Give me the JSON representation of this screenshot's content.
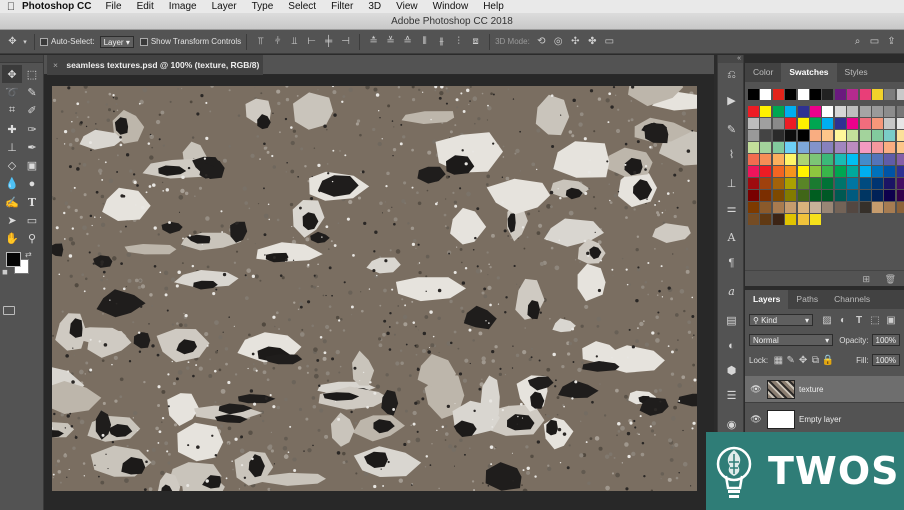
{
  "menubar": {
    "apple_icon": "apple-icon",
    "app_name": "Photoshop CC",
    "items": [
      "File",
      "Edit",
      "Image",
      "Layer",
      "Type",
      "Select",
      "Filter",
      "3D",
      "View",
      "Window",
      "Help"
    ]
  },
  "window": {
    "title": "Adobe Photoshop CC 2018"
  },
  "options": {
    "auto_select_label": "Auto-Select:",
    "auto_select_value": "Layer",
    "show_transform_label": "Show Transform Controls",
    "mode_3d_label": "3D Mode:"
  },
  "document": {
    "tab_title": "seamless textures.psd @ 100% (texture, RGB/8)",
    "close_glyph": "×"
  },
  "swatches_panel": {
    "tabs": [
      "Color",
      "Swatches",
      "Styles"
    ],
    "active_tab": "Swatches",
    "rows": [
      [
        "#000000",
        "#ffffff",
        "#e2231a",
        "#000000",
        "#ffffff",
        "#000000",
        "#222222",
        "#6a1a7e",
        "#b52a8e",
        "#e93e78",
        "#f2d22b",
        "#7d7d7d",
        "#c9c9c9"
      ],
      [
        "#ed1c24",
        "#fff200",
        "#00a651",
        "#00aeef",
        "#2e3192",
        "#ec008c",
        "#ffffff",
        "#d7d7d7",
        "#bfbfbf",
        "#a5a5a5",
        "#9a9a9a",
        "#8c8c8c",
        "#777777"
      ],
      [
        "#bdbdbd",
        "#a0a0a0",
        "#8a8a8a",
        "#ed1c24",
        "#fff200",
        "#00a651",
        "#00aeef",
        "#2e3192",
        "#ec008c",
        "#f26d7d",
        "#f7977a",
        "#c7c7c7",
        "#e6e6e6"
      ],
      [
        "#999999",
        "#444444",
        "#2b2b2b",
        "#0d0d0d",
        "#000000",
        "#f9ad81",
        "#fdc68a",
        "#fff79a",
        "#c4df9b",
        "#a3d39c",
        "#82ca9d",
        "#7accc8",
        "#fbe09a"
      ],
      [
        "#c4df9b",
        "#a3d39c",
        "#82ca9d",
        "#6dcff6",
        "#7da7d9",
        "#8393ca",
        "#8781bd",
        "#a186be",
        "#bd8cbf",
        "#f49ac1",
        "#f5989d",
        "#f9ad81",
        "#fdc68a"
      ],
      [
        "#f26c4f",
        "#f68e56",
        "#fbaf5d",
        "#fff568",
        "#acd372",
        "#7cc576",
        "#3bb878",
        "#1abbb4",
        "#00bff3",
        "#438ccb",
        "#5574b9",
        "#605ca8",
        "#855fa8"
      ],
      [
        "#ed145b",
        "#ed1c24",
        "#f26522",
        "#f7941d",
        "#fff200",
        "#8dc63f",
        "#39b54a",
        "#00a651",
        "#00a99d",
        "#00aeef",
        "#0072bc",
        "#0054a6",
        "#2e3192"
      ],
      [
        "#9e0b0f",
        "#a0410d",
        "#a36209",
        "#aba000",
        "#598527",
        "#1a7b30",
        "#007236",
        "#00746b",
        "#0076a3",
        "#004b80",
        "#003471",
        "#1b1464",
        "#440e62"
      ],
      [
        "#790000",
        "#7b2e00",
        "#7d4900",
        "#827b00",
        "#406618",
        "#005e20",
        "#005826",
        "#005952",
        "#005b7f",
        "#003663",
        "#002157",
        "#0d004c",
        "#32004b"
      ],
      [
        "#7d3a00",
        "#8b5a2b",
        "#a87b4f",
        "#c69c6d",
        "#d9b27c",
        "#c7b299",
        "#998675",
        "#736357",
        "#534741",
        "#36302a",
        "#c69c6d",
        "#a67c52",
        "#8c6239"
      ],
      [
        "#754c24",
        "#603913",
        "#3c2415",
        "#e0c300",
        "#f0c23b",
        "#f5e11a",
        "",
        "",
        "",
        "",
        "",
        "",
        ""
      ]
    ],
    "footer_icons": [
      "new-swatch-icon",
      "delete-icon"
    ]
  },
  "layers_panel": {
    "tabs": [
      "Layers",
      "Paths",
      "Channels"
    ],
    "active_tab": "Layers",
    "filter_label": "Kind",
    "blend_mode": "Normal",
    "opacity_label": "Opacity:",
    "opacity_value": "100%",
    "lock_label": "Lock:",
    "fill_label": "Fill:",
    "fill_value": "100%",
    "layers": [
      {
        "name": "texture",
        "selected": true
      },
      {
        "name": "Empty layer",
        "selected": false
      }
    ]
  },
  "watermark": {
    "text": "TWOS"
  },
  "colors": {
    "ui_dark": "#535353",
    "canvas_bg": "#282828",
    "watermark_bg": "#2f7d77"
  }
}
